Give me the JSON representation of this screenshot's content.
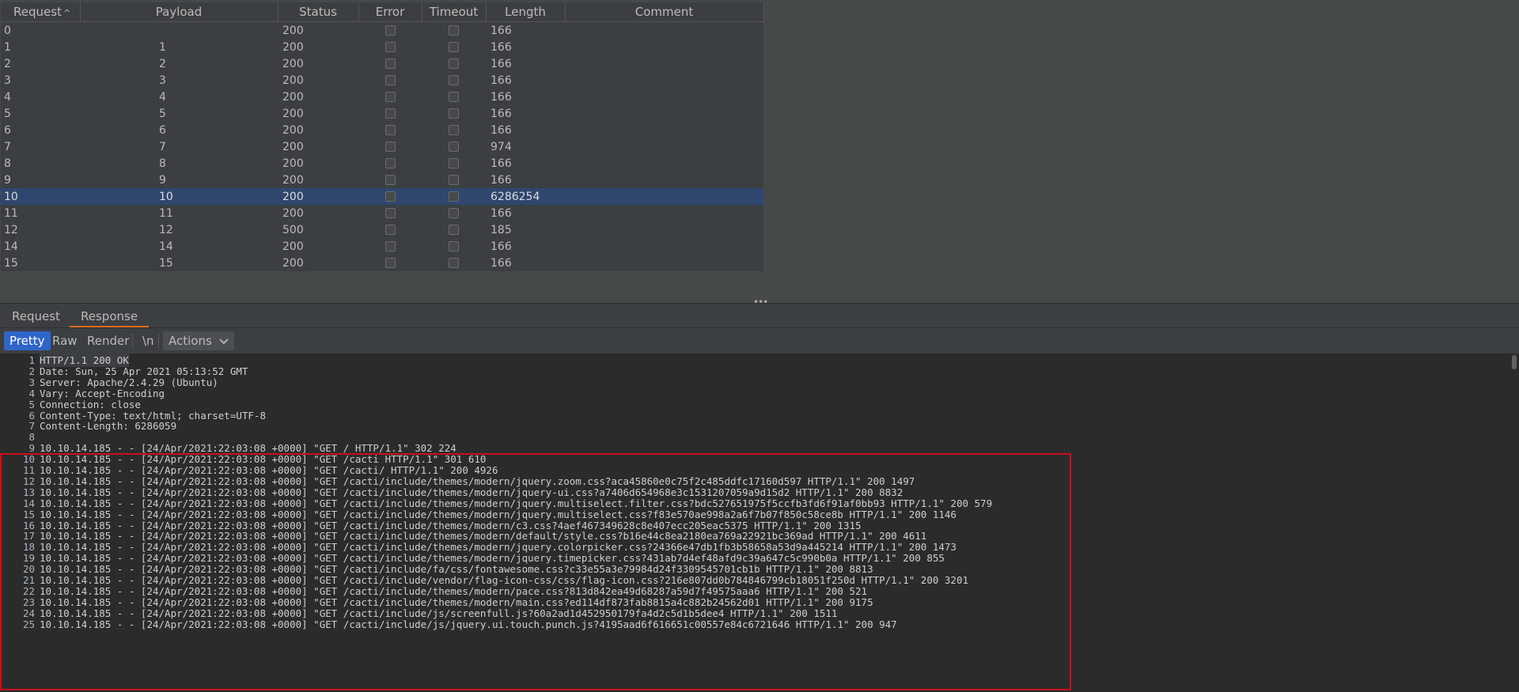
{
  "results_table": {
    "columns": [
      "Request",
      "Payload",
      "Status",
      "Error",
      "Timeout",
      "Length",
      "Comment"
    ],
    "sort_indicator": "^",
    "selected_row_index": 10,
    "rows": [
      {
        "request": "0",
        "payload": "",
        "status": "200",
        "length": "166"
      },
      {
        "request": "1",
        "payload": "1",
        "status": "200",
        "length": "166"
      },
      {
        "request": "2",
        "payload": "2",
        "status": "200",
        "length": "166"
      },
      {
        "request": "3",
        "payload": "3",
        "status": "200",
        "length": "166"
      },
      {
        "request": "4",
        "payload": "4",
        "status": "200",
        "length": "166"
      },
      {
        "request": "5",
        "payload": "5",
        "status": "200",
        "length": "166"
      },
      {
        "request": "6",
        "payload": "6",
        "status": "200",
        "length": "166"
      },
      {
        "request": "7",
        "payload": "7",
        "status": "200",
        "length": "974"
      },
      {
        "request": "8",
        "payload": "8",
        "status": "200",
        "length": "166"
      },
      {
        "request": "9",
        "payload": "9",
        "status": "200",
        "length": "166"
      },
      {
        "request": "10",
        "payload": "10",
        "status": "200",
        "length": "6286254"
      },
      {
        "request": "11",
        "payload": "11",
        "status": "200",
        "length": "166"
      },
      {
        "request": "12",
        "payload": "12",
        "status": "500",
        "length": "185"
      },
      {
        "request": "14",
        "payload": "14",
        "status": "200",
        "length": "166"
      },
      {
        "request": "15",
        "payload": "15",
        "status": "200",
        "length": "166"
      }
    ]
  },
  "splitter": {
    "glyph": "•••"
  },
  "tabs": {
    "request": "Request",
    "response": "Response",
    "active": "response"
  },
  "toolbar": {
    "pretty": "Pretty",
    "raw": "Raw",
    "render": "Render",
    "newline": "\\n",
    "actions": "Actions",
    "actions_icon": "chevron-down-icon"
  },
  "editor": {
    "lines": [
      "HTTP/1.1 200 OK",
      "Date: Sun, 25 Apr 2021 05:13:52 GMT",
      "Server: Apache/2.4.29 (Ubuntu)",
      "Vary: Accept-Encoding",
      "Connection: close",
      "Content-Type: text/html; charset=UTF-8",
      "Content-Length: 6286059",
      "",
      "10.10.14.185 - - [24/Apr/2021:22:03:08 +0000] \"GET / HTTP/1.1\" 302 224",
      "10.10.14.185 - - [24/Apr/2021:22:03:08 +0000] \"GET /cacti HTTP/1.1\" 301 610",
      "10.10.14.185 - - [24/Apr/2021:22:03:08 +0000] \"GET /cacti/ HTTP/1.1\" 200 4926",
      "10.10.14.185 - - [24/Apr/2021:22:03:08 +0000] \"GET /cacti/include/themes/modern/jquery.zoom.css?aca45860e0c75f2c485ddfc17160d597 HTTP/1.1\" 200 1497",
      "10.10.14.185 - - [24/Apr/2021:22:03:08 +0000] \"GET /cacti/include/themes/modern/jquery-ui.css?a7406d654968e3c1531207059a9d15d2 HTTP/1.1\" 200 8832",
      "10.10.14.185 - - [24/Apr/2021:22:03:08 +0000] \"GET /cacti/include/themes/modern/jquery.multiselect.filter.css?bdc527651975f5ccfb3fd6f91af0bb93 HTTP/1.1\" 200 579",
      "10.10.14.185 - - [24/Apr/2021:22:03:08 +0000] \"GET /cacti/include/themes/modern/jquery.multiselect.css?f83e570ae998a2a6f7b07f850c58ce8b HTTP/1.1\" 200 1146",
      "10.10.14.185 - - [24/Apr/2021:22:03:08 +0000] \"GET /cacti/include/themes/modern/c3.css?4aef467349628c8e407ecc205eac5375 HTTP/1.1\" 200 1315",
      "10.10.14.185 - - [24/Apr/2021:22:03:08 +0000] \"GET /cacti/include/themes/modern/default/style.css?b16e44c8ea2180ea769a22921bc369ad HTTP/1.1\" 200 4611",
      "10.10.14.185 - - [24/Apr/2021:22:03:08 +0000] \"GET /cacti/include/themes/modern/jquery.colorpicker.css?24366e47db1fb3b58658a53d9a445214 HTTP/1.1\" 200 1473",
      "10.10.14.185 - - [24/Apr/2021:22:03:08 +0000] \"GET /cacti/include/themes/modern/jquery.timepicker.css?431ab7d4ef48afd9c39a647c5c990b0a HTTP/1.1\" 200 855",
      "10.10.14.185 - - [24/Apr/2021:22:03:08 +0000] \"GET /cacti/include/fa/css/fontawesome.css?c33e55a3e79984d24f3309545701cb1b HTTP/1.1\" 200 8813",
      "10.10.14.185 - - [24/Apr/2021:22:03:08 +0000] \"GET /cacti/include/vendor/flag-icon-css/css/flag-icon.css?216e807dd0b784846799cb18051f250d HTTP/1.1\" 200 3201",
      "10.10.14.185 - - [24/Apr/2021:22:03:08 +0000] \"GET /cacti/include/themes/modern/pace.css?813d842ea49d68287a59d7f49575aaa6 HTTP/1.1\" 200 521",
      "10.10.14.185 - - [24/Apr/2021:22:03:08 +0000] \"GET /cacti/include/themes/modern/main.css?ed114df873fab8815a4c882b24562d01 HTTP/1.1\" 200 9175",
      "10.10.14.185 - - [24/Apr/2021:22:03:08 +0000] \"GET /cacti/include/js/screenfull.js?60a2ad1d452950179fa4d2c5d1b5dee4 HTTP/1.1\" 200 1511",
      "10.10.14.185 - - [24/Apr/2021:22:03:08 +0000] \"GET /cacti/include/js/jquery.ui.touch.punch.js?4195aad6f616651c00557e84c6721646 HTTP/1.1\" 200 947"
    ],
    "highlight_color": "#c9101a"
  },
  "colors": {
    "background": "#3c3f41",
    "editor_background": "#2b2b2b",
    "selected_row": "#2f466f",
    "active_button": "#2f65ca",
    "active_tab_underline": "#e06c23"
  }
}
